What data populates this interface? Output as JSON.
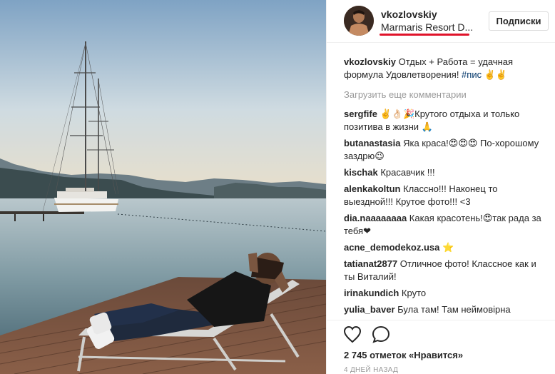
{
  "post": {
    "username": "vkozlovskiy",
    "location": "Marmaris Resort D...",
    "follow_label": "Подписки"
  },
  "caption": {
    "username": "vkozlovskiy",
    "text": " Отдых + Работа = удачная формула Удовлетворения! ",
    "hashtag": "#пис",
    "tail": " ✌️✌️"
  },
  "load_more_label": "Загрузить еще комментарии",
  "comments": [
    {
      "user": "sergfife",
      "text": " ✌️👌🏻🎉Крутого отдыха и только позитива в жизни 🙏"
    },
    {
      "user": "butanastasia",
      "text": " Яка краса!😍😍😍 По-хорошому заздрю😉"
    },
    {
      "user": "kischak",
      "text": " Красавчик !!!"
    },
    {
      "user": "alenkakoltun",
      "text": " Классно!!! Наконец то выездной!!! Крутое фото!!! <3"
    },
    {
      "user": "dia.naaaaaaaa",
      "text": " Какая красотень!😍так рада за тебя❤"
    },
    {
      "user": "acne_demodekoz.usa",
      "text": " ⭐"
    },
    {
      "user": "tatianat2877",
      "text": " Отличное фото! Классное как и ты Виталий!"
    },
    {
      "user": "irinakundich",
      "text": " Круто"
    },
    {
      "user": "yulia_baver",
      "text": " Була там! Там неймовірна"
    }
  ],
  "likes": "2 745 отметок «Нравится»",
  "timestamp": "4 дней назад",
  "colors": {
    "highlight_underline": "#e0132a",
    "hashtag": "#003569",
    "muted": "#999999"
  },
  "icons": {
    "like": "heart-icon",
    "comment": "comment-bubble-icon"
  }
}
